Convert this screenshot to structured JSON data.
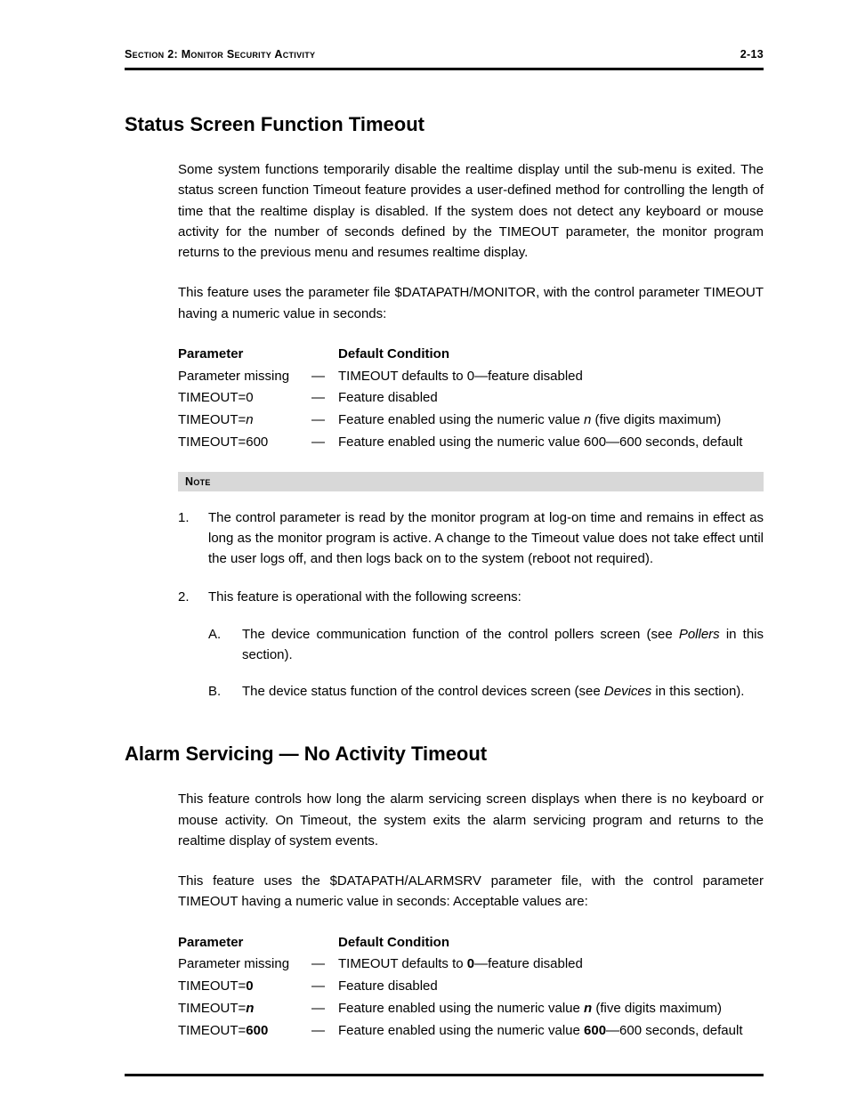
{
  "header": {
    "section_prefix": "Section 2: ",
    "section_title": "Monitor Security Activity",
    "page_number": "2-13"
  },
  "section1": {
    "title": "Status Screen Function Timeout",
    "para1": "Some system functions temporarily disable the realtime display until the sub-menu is exited.  The status screen function Timeout feature provides a user-defined method for controlling the length of time that the realtime display is disabled.  If the system does not detect any keyboard or mouse activity for the number of seconds defined by the TIMEOUT parameter, the monitor program returns to the previous menu and resumes realtime display.",
    "para2": "This feature uses the parameter file $DATAPATH/MONITOR, with the control parameter TIMEOUT having a numeric value in seconds:",
    "table": {
      "head_param": "Parameter",
      "head_cond": "Default Condition",
      "rows": [
        {
          "param": "Parameter missing",
          "cond": "TIMEOUT defaults to 0—feature disabled"
        },
        {
          "param": "TIMEOUT=0",
          "cond": "Feature disabled"
        },
        {
          "param_prefix": "TIMEOUT=",
          "param_ital": "n",
          "cond_prefix": "Feature enabled using the numeric value ",
          "cond_ital": "n",
          "cond_suffix": " (five digits maximum)"
        },
        {
          "param": "TIMEOUT=600",
          "cond": "Feature enabled using the numeric value 600—600 seconds, default"
        }
      ]
    },
    "note_label": "Note",
    "notes": {
      "item1": "The control parameter is read by the monitor program at log-on time and remains in effect as long as the monitor program is active.  A change to the Timeout value does not take effect until the user logs off, and then logs back on to the system (reboot not required).",
      "item2_intro": "This feature is operational with the following screens:",
      "subA_pre": "The device communication function of the control pollers screen (see ",
      "subA_ital": "Pollers",
      "subA_post": " in this section).",
      "subB_pre": "The device status function of the control devices screen (see ",
      "subB_ital": "Devices",
      "subB_post": " in this section)."
    }
  },
  "section2": {
    "title": "Alarm Servicing — No Activity Timeout",
    "para1": "This feature controls how long the alarm servicing screen displays when there is no keyboard or mouse activity.  On Timeout, the system exits the alarm servicing program and returns to the realtime display of system events.",
    "para2": "This feature uses the $DATAPATH/ALARMSRV parameter file, with the control parameter TIMEOUT having a numeric value in seconds:  Acceptable values are:",
    "table": {
      "head_param": "Parameter",
      "head_cond": "Default Condition",
      "rows": [
        {
          "param": "Parameter missing",
          "cond_pre": "TIMEOUT defaults to ",
          "cond_bold": "0",
          "cond_post": "—feature disabled"
        },
        {
          "param_prefix": "TIMEOUT=",
          "param_bold": "0",
          "cond": "Feature disabled"
        },
        {
          "param_prefix": "TIMEOUT=",
          "param_bolditalic": "n",
          "cond_pre": "Feature enabled using the numeric value ",
          "cond_bolditalic": "n",
          "cond_post": " (five digits maximum)"
        },
        {
          "param_prefix": "TIMEOUT=",
          "param_bold": "600",
          "cond_pre": "Feature enabled using the numeric value ",
          "cond_bold": "600",
          "cond_post": "—600 seconds, default"
        }
      ]
    }
  }
}
